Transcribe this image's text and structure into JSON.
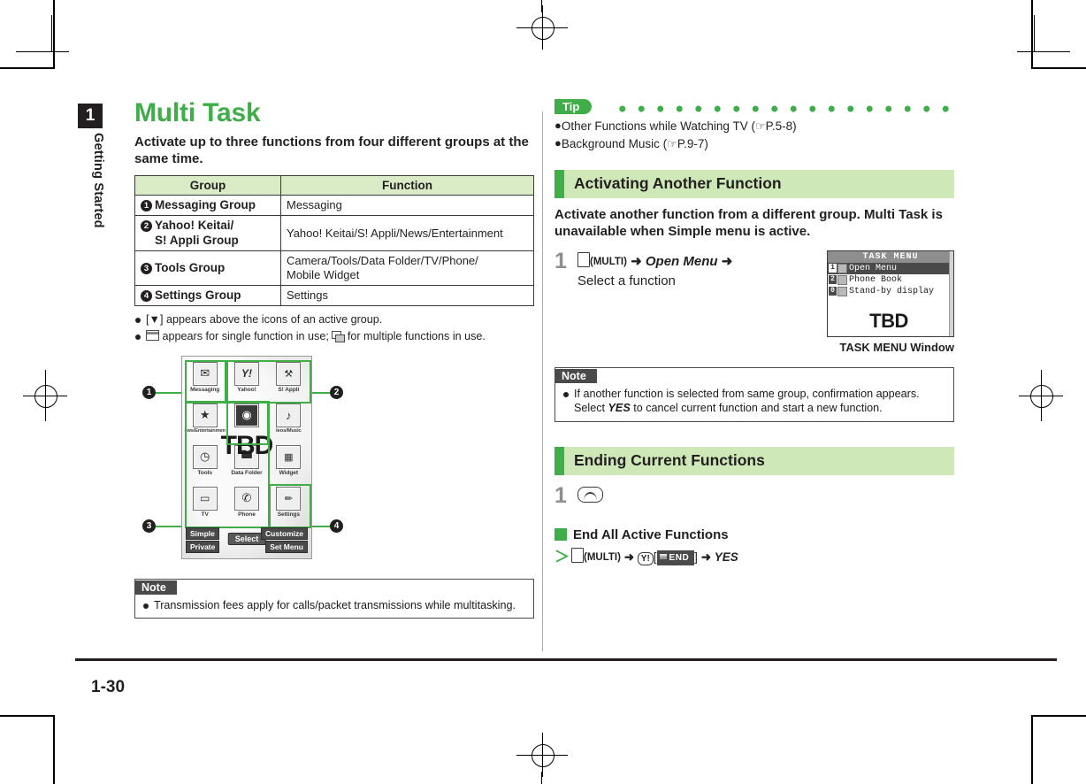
{
  "meta": {
    "chapter_number": "1",
    "chapter_label": "Getting Started",
    "page_number": "1-30"
  },
  "colors": {
    "accent_green": "#3fae49",
    "header_green": "#cfe8b7",
    "table_header_green": "#d9ecc6",
    "dark": "#231f20",
    "note_header_gray": "#4a4a4a"
  },
  "left": {
    "title": "Multi Task",
    "lead": "Activate up to three functions from four different groups at the same time.",
    "table": {
      "headers": [
        "Group",
        "Function"
      ],
      "rows": [
        {
          "num": "1",
          "group": "Messaging Group",
          "group_line2": "",
          "function": "Messaging"
        },
        {
          "num": "2",
          "group": "Yahoo! Keitai/",
          "group_line2": "S! Appli Group",
          "function": "Yahoo! Keitai/S! Appli/News/Entertainment"
        },
        {
          "num": "3",
          "group": "Tools Group",
          "group_line2": "",
          "function": "Camera/Tools/Data Folder/TV/Phone/\nMobile Widget"
        },
        {
          "num": "4",
          "group": "Settings Group",
          "group_line2": "",
          "function": "Settings"
        }
      ]
    },
    "bullets": [
      "[▼] appears above the icons of an active group.",
      "appears for single function in use;  for multiple functions in use."
    ],
    "bullet2_pre": "",
    "bullet2_mid": "appears for single function in use;",
    "bullet2_end": "for multiple functions in use.",
    "mock": {
      "tbd": "TBD",
      "icons": [
        {
          "label": "Messaging",
          "glyph": "✉",
          "name": "messaging-icon"
        },
        {
          "label": "Yahoo!",
          "glyph": "Y!",
          "name": "yahoo-icon"
        },
        {
          "label": "S! Appli",
          "glyph": "🎮",
          "name": "s-appli-icon"
        },
        {
          "label": "ews/Entertainmen",
          "glyph": "★",
          "name": "news-entertainment-icon"
        },
        {
          "label": "",
          "glyph": "◉",
          "name": "camera-icon"
        },
        {
          "label": "leos/Music",
          "glyph": "♪",
          "name": "videos-music-icon"
        },
        {
          "label": "Tools",
          "glyph": "◷",
          "name": "tools-icon"
        },
        {
          "label": "Data Folder",
          "glyph": "🗀",
          "name": "data-folder-icon"
        },
        {
          "label": "Widget",
          "glyph": "▦",
          "name": "widget-icon"
        },
        {
          "label": "TV",
          "glyph": "🖵",
          "name": "tv-icon"
        },
        {
          "label": "Phone",
          "glyph": "✆",
          "name": "phone-icon"
        },
        {
          "label": "Settings",
          "glyph": "🔧",
          "name": "settings-icon"
        }
      ],
      "softkeys": {
        "left_top": "Simple",
        "left_bottom": "Private",
        "center": "Select",
        "right_top": "Customize",
        "right_bottom": "Set Menu"
      },
      "callouts": [
        "1",
        "2",
        "3",
        "4"
      ]
    },
    "note": {
      "title": "Note",
      "body": "Transmission fees apply for calls/packet transmissions while multitasking."
    }
  },
  "right": {
    "tip": {
      "badge": "Tip",
      "items": [
        {
          "text": "Other Functions while Watching TV (",
          "ref": "P.5-8",
          "suffix": ")"
        },
        {
          "text": "Background Music (",
          "ref": "P.9-7",
          "suffix": ")"
        }
      ]
    },
    "section1": {
      "heading": "Activating Another Function",
      "lead": "Activate another function from a different group. Multi Task is unavailable when Simple menu is active.",
      "step": {
        "number": "1",
        "key_label": "(MULTI)",
        "arrow1": "➜",
        "italic1": "Open Menu",
        "arrow2": "➜",
        "line2": "Select a function"
      },
      "taskwin": {
        "title": "TASK MENU",
        "rows": [
          {
            "key": "1",
            "label": "Open Menu",
            "selected": true
          },
          {
            "key": "2",
            "label": "Phone Book",
            "selected": false
          },
          {
            "key": "0",
            "label": "Stand-by display",
            "selected": false
          }
        ],
        "tbd": "TBD",
        "caption": "TASK MENU Window"
      },
      "note": {
        "title": "Note",
        "body_pre": "If another function is selected from same group, confirmation appears. Select ",
        "body_em": "YES",
        "body_post": " to cancel current function and start a new function."
      }
    },
    "section2": {
      "heading": "Ending Current Functions",
      "step_number": "1",
      "step_key": "end-key",
      "subsection": "End All Active Functions",
      "sequence": {
        "gt": "＞",
        "key_label": "(MULTI)",
        "arrow1": "➜",
        "yh_key": "Y!",
        "bracket_open": "[",
        "end_button": "END",
        "bracket_close": "]",
        "arrow2": "➜",
        "yes": "YES"
      }
    }
  }
}
